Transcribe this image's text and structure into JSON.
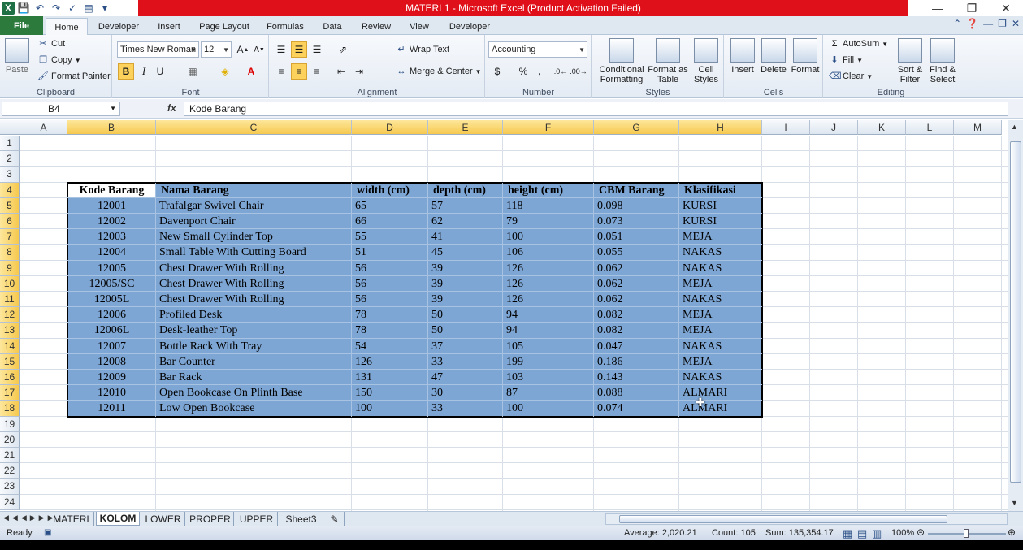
{
  "window": {
    "title": "MATERI 1  -  Microsoft Excel (Product Activation Failed)"
  },
  "ribbon_tabs": [
    "File",
    "Home",
    "Developer",
    "Insert",
    "Page Layout",
    "Formulas",
    "Data",
    "Review",
    "View",
    "Developer"
  ],
  "ribbon": {
    "clipboard": {
      "label": "Clipboard",
      "paste": "Paste",
      "cut": "Cut",
      "copy": "Copy",
      "format_painter": "Format Painter"
    },
    "font": {
      "label": "Font",
      "font_name": "Times New Roman",
      "font_size": "12",
      "bold": "B",
      "italic": "I",
      "underline": "U"
    },
    "alignment": {
      "label": "Alignment",
      "wrap_text": "Wrap Text",
      "merge_center": "Merge & Center"
    },
    "number": {
      "label": "Number",
      "format": "Accounting",
      "currency": "$",
      "percent": "%",
      "comma": ","
    },
    "styles": {
      "label": "Styles",
      "conditional": "Conditional Formatting",
      "format_table": "Format as Table",
      "cell_styles": "Cell Styles"
    },
    "cells": {
      "label": "Cells",
      "insert": "Insert",
      "delete": "Delete",
      "format": "Format"
    },
    "editing": {
      "label": "Editing",
      "autosum": "AutoSum",
      "fill": "Fill",
      "clear": "Clear",
      "sort_filter": "Sort & Filter",
      "find_select": "Find & Select"
    }
  },
  "formula_bar": {
    "name_box": "B4",
    "fx": "fx",
    "content": "Kode Barang"
  },
  "columns": [
    "A",
    "B",
    "C",
    "D",
    "E",
    "F",
    "G",
    "H",
    "I",
    "J",
    "K",
    "L",
    "M"
  ],
  "rows": [
    "1",
    "2",
    "3",
    "4",
    "5",
    "6",
    "7",
    "8",
    "9",
    "10",
    "11",
    "12",
    "13",
    "14",
    "15",
    "16",
    "17",
    "18",
    "19",
    "20",
    "21",
    "22",
    "23",
    "24"
  ],
  "table": {
    "headers": [
      "Kode Barang",
      "Nama Barang",
      "width (cm)",
      "depth (cm)",
      "height (cm)",
      "CBM Barang",
      "Klasifikasi"
    ],
    "rows": [
      [
        "12001",
        "Trafalgar Swivel Chair",
        "65",
        "57",
        "118",
        "0.098",
        "KURSI"
      ],
      [
        "12002",
        "Davenport Chair",
        "66",
        "62",
        "79",
        "0.073",
        "KURSI"
      ],
      [
        "12003",
        "New Small Cylinder Top",
        "55",
        "41",
        "100",
        "0.051",
        "MEJA"
      ],
      [
        "12004",
        "Small Table With Cutting Board",
        "51",
        "45",
        "106",
        "0.055",
        "NAKAS"
      ],
      [
        "12005",
        "Chest Drawer With Rolling",
        "56",
        "39",
        "126",
        "0.062",
        "NAKAS"
      ],
      [
        "12005/SC",
        "Chest Drawer With Rolling",
        "56",
        "39",
        "126",
        "0.062",
        "MEJA"
      ],
      [
        "12005L",
        "Chest Drawer With Rolling",
        "56",
        "39",
        "126",
        "0.062",
        "NAKAS"
      ],
      [
        "12006",
        "Profiled Desk",
        "78",
        "50",
        "94",
        "0.082",
        "MEJA"
      ],
      [
        "12006L",
        "Desk-leather Top",
        "78",
        "50",
        "94",
        "0.082",
        "MEJA"
      ],
      [
        "12007",
        "Bottle Rack With Tray",
        "54",
        "37",
        "105",
        "0.047",
        "NAKAS"
      ],
      [
        "12008",
        "Bar Counter",
        "126",
        "33",
        "199",
        "0.186",
        "MEJA"
      ],
      [
        "12009",
        "Bar Rack",
        "131",
        "47",
        "103",
        "0.143",
        "NAKAS"
      ],
      [
        "12010",
        "Open Bookcase On Plinth Base",
        "150",
        "30",
        "87",
        "0.088",
        "ALMARI"
      ],
      [
        "12011",
        "Low Open Bookcase",
        "100",
        "33",
        "100",
        "0.074",
        "ALMARI"
      ]
    ]
  },
  "sheets": [
    "MATERI",
    "KOLOM",
    "LOWER",
    "PROPER",
    "UPPER",
    "Sheet3"
  ],
  "active_sheet": "KOLOM",
  "status": {
    "mode": "Ready",
    "average": "Average: 2,020.21",
    "count": "Count: 105",
    "sum": "Sum: 135,354.17",
    "zoom": "100%"
  }
}
